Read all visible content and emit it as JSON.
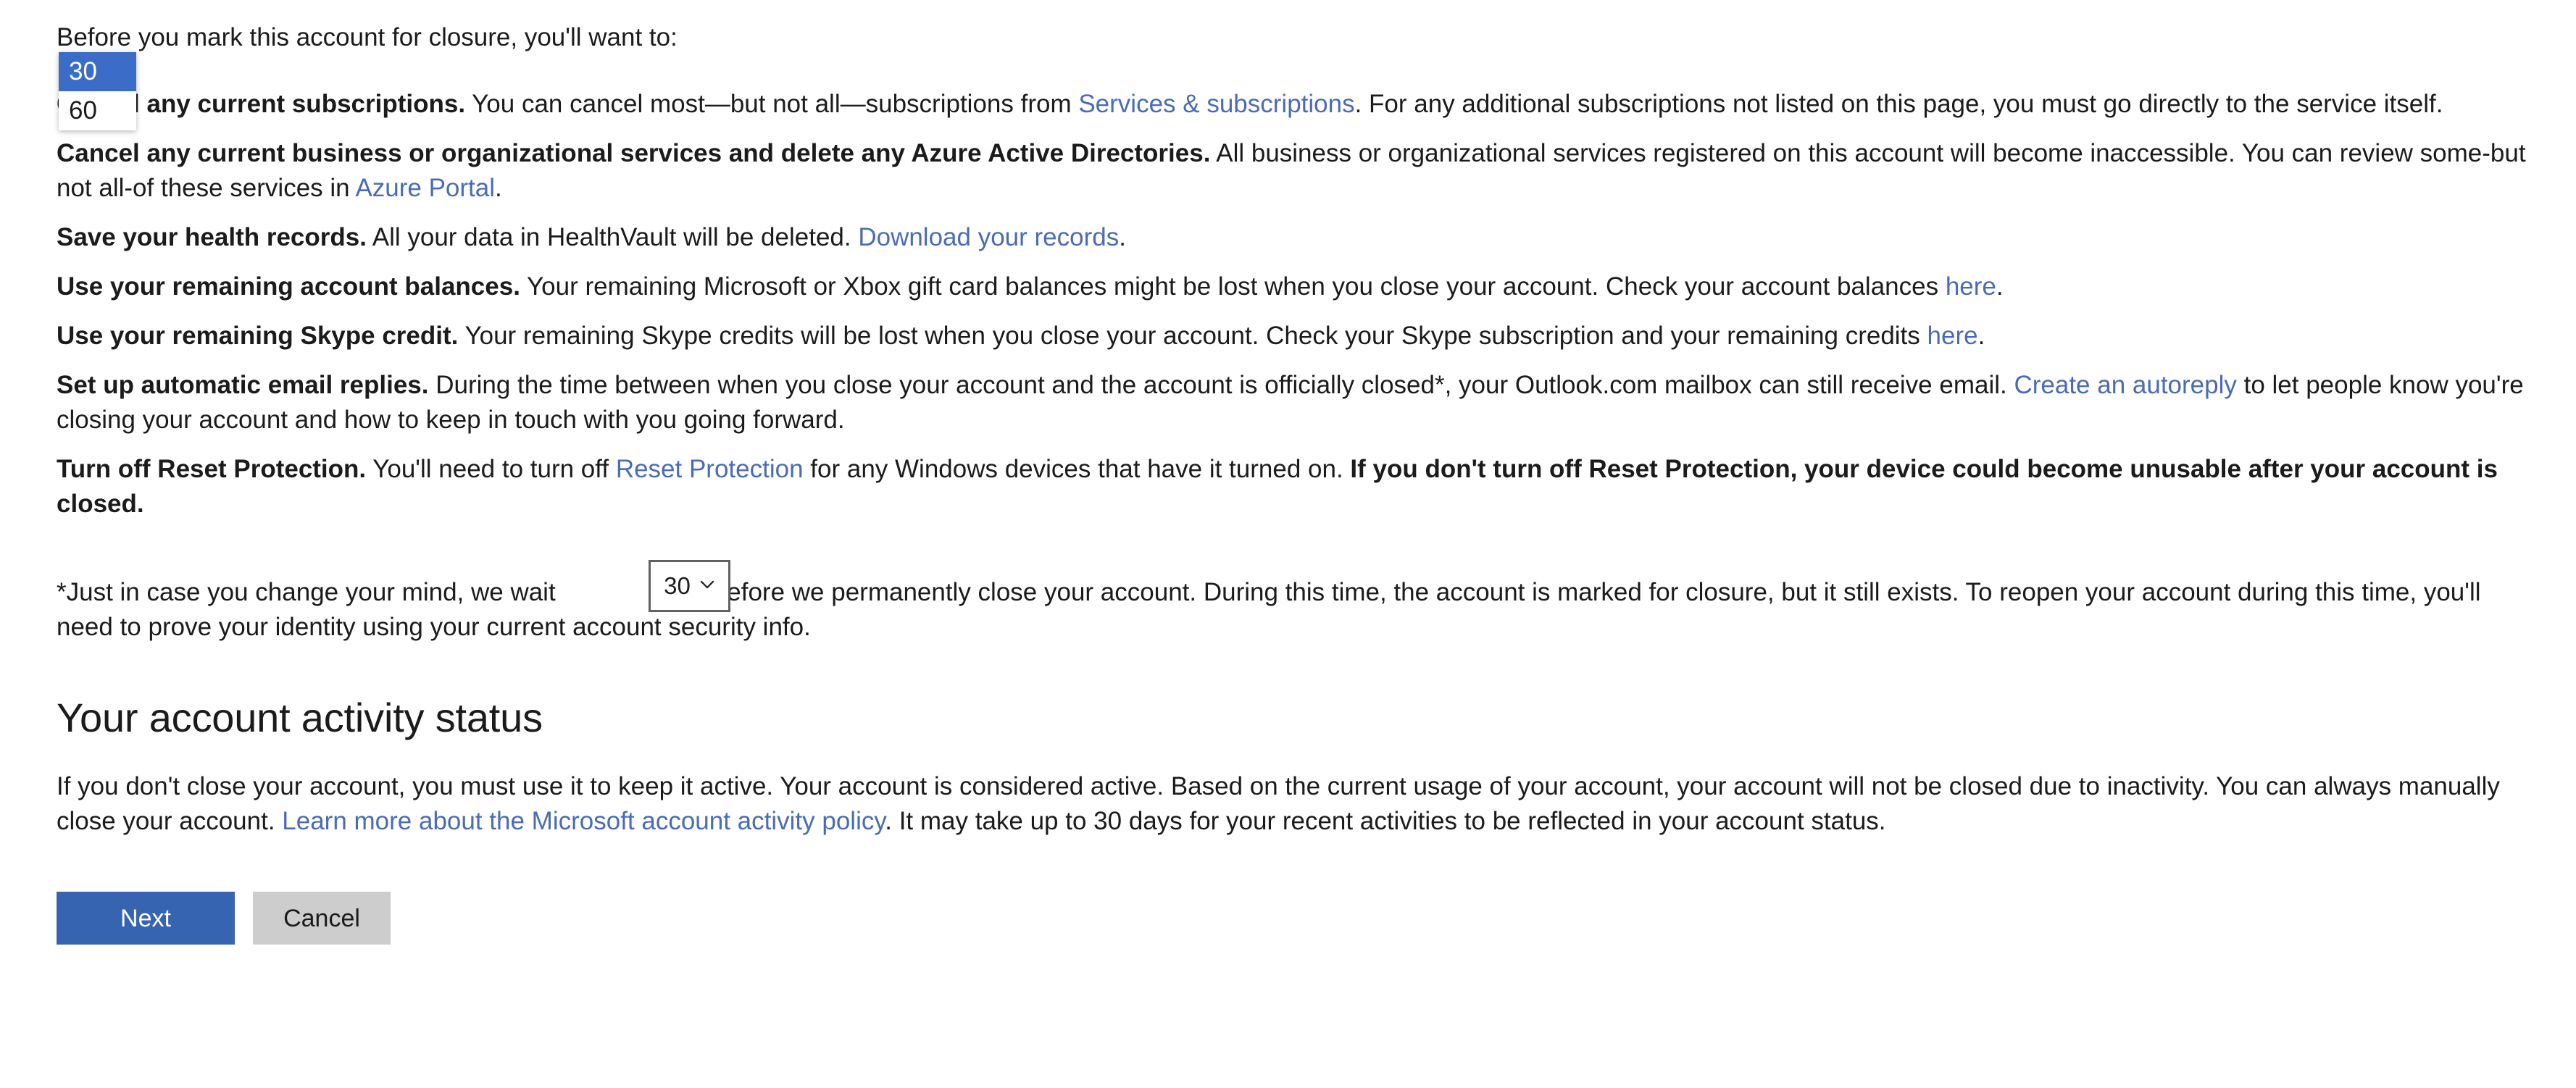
{
  "intro": "Before you mark this account for closure, you'll want to:",
  "checklist": [
    {
      "lead": "Cancel any current subscriptions.",
      "parts": [
        {
          "t": "text",
          "v": " You can cancel most—but not all—subscriptions from "
        },
        {
          "t": "link",
          "v": "Services & subscriptions"
        },
        {
          "t": "text",
          "v": ". For any additional subscriptions not listed on this page, you must go directly to the service itself."
        }
      ]
    },
    {
      "lead": "Cancel any current business or organizational services and delete any Azure Active Directories.",
      "parts": [
        {
          "t": "text",
          "v": " All business or organizational services registered on this account will become inaccessible. You can review some-but not all-of these services in "
        },
        {
          "t": "link",
          "v": "Azure Portal"
        },
        {
          "t": "text",
          "v": "."
        }
      ]
    },
    {
      "lead": "Save your health records.",
      "parts": [
        {
          "t": "text",
          "v": " All your data in HealthVault will be deleted. "
        },
        {
          "t": "link",
          "v": "Download your records"
        },
        {
          "t": "text",
          "v": "."
        }
      ]
    },
    {
      "lead": "Use your remaining account balances.",
      "parts": [
        {
          "t": "text",
          "v": " Your remaining Microsoft or Xbox gift card balances might be lost when you close your account. Check your account balances "
        },
        {
          "t": "link",
          "v": "here"
        },
        {
          "t": "text",
          "v": "."
        }
      ]
    },
    {
      "lead": "Use your remaining Skype credit.",
      "parts": [
        {
          "t": "text",
          "v": " Your remaining Skype credits will be lost when you close your account. Check your Skype subscription and your remaining credits "
        },
        {
          "t": "link",
          "v": "here"
        },
        {
          "t": "text",
          "v": "."
        }
      ]
    },
    {
      "lead": "Set up automatic email replies.",
      "parts": [
        {
          "t": "text",
          "v": " During the time between when you close your account and the account is officially closed*, your Outlook.com mailbox can still receive email. "
        },
        {
          "t": "link",
          "v": "Create an autoreply"
        },
        {
          "t": "text",
          "v": " to let people know you're closing your account and how to keep in touch with you going forward."
        }
      ]
    },
    {
      "lead": "Turn off Reset Protection.",
      "parts": [
        {
          "t": "text",
          "v": " You'll need to turn off "
        },
        {
          "t": "link",
          "v": "Reset Protection"
        },
        {
          "t": "text",
          "v": " for any Windows devices that have it turned on. "
        },
        {
          "t": "bold",
          "v": "If you don't turn off Reset Protection, your device could become unusable after your account is closed."
        }
      ]
    }
  ],
  "footnote": {
    "before_select": "*Just in case you change your mind, we wait ",
    "after_select": " days before we permanently close your account. During this time, the account is marked for closure, but it still exists. To reopen your account during this time, you'll need to prove your identity using your current account security info."
  },
  "wait_days_select": {
    "value": "30",
    "expanded": true,
    "options": [
      {
        "label": "30",
        "selected": true
      },
      {
        "label": "60",
        "selected": false
      }
    ],
    "highlight_color": "#3a6cc8",
    "border_color": "#616161"
  },
  "activity_section": {
    "heading": "Your account activity status",
    "paragraph_parts": [
      {
        "t": "text",
        "v": "If you don't close your account, you must use it to keep it active. Your account is considered active. Based on the current usage of your account, your account will not be closed due to inactivity. You can always manually close your account. "
      },
      {
        "t": "link",
        "v": "Learn more about the Microsoft account activity policy"
      },
      {
        "t": "text",
        "v": ". It may take up to 30 days for your recent activities to be reflected in your account status."
      }
    ]
  },
  "buttons": {
    "next": "Next",
    "cancel": "Cancel"
  },
  "colors": {
    "link": "#4a6bb5",
    "primary_button_bg": "#3664b0",
    "secondary_button_bg": "#cdcdcd",
    "text": "#1b1b1b"
  }
}
